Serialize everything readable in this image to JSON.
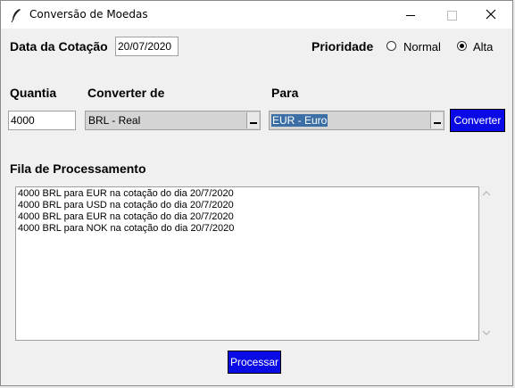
{
  "window": {
    "title": "Conversão de Moedas"
  },
  "form": {
    "date_label": "Data da Cotação",
    "date_value": "20/07/2020",
    "priority_label": "Prioridade",
    "priority_options": [
      {
        "label": "Normal",
        "selected": false
      },
      {
        "label": "Alta",
        "selected": true
      }
    ],
    "quantity_label": "Quantia",
    "quantity_value": "4000",
    "from_label": "Converter de",
    "from_value": "BRL - Real",
    "to_label": "Para",
    "to_value": "EUR - Euro",
    "convert_button": "Converter"
  },
  "queue": {
    "label": "Fila de Processamento",
    "items": [
      "4000 BRL para EUR na cotação do dia 20/7/2020",
      "4000 BRL para USD na cotação do dia 20/7/2020",
      "4000 BRL para EUR na cotação do dia 20/7/2020",
      "4000 BRL para NOK na cotação do dia 20/7/2020"
    ],
    "process_button": "Processar"
  },
  "colors": {
    "button_bg": "#0a0ae6",
    "selection_bg": "#3b6ea5",
    "window_bg": "#f0f0f0"
  }
}
